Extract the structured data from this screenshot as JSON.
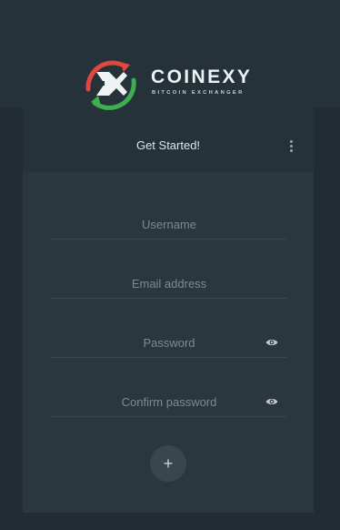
{
  "brand": {
    "name": "COINEXY",
    "tagline": "BITCOIN EXCHANGER"
  },
  "header": {
    "title": "Get Started!",
    "menu_icon": "more-vertical-icon"
  },
  "form": {
    "username": {
      "placeholder": "Username",
      "value": ""
    },
    "email": {
      "placeholder": "Email address",
      "value": ""
    },
    "password": {
      "placeholder": "Password",
      "value": "",
      "toggle_icon": "eye-icon"
    },
    "confirm_password": {
      "placeholder": "Confirm password",
      "value": "",
      "toggle_icon": "eye-icon"
    },
    "submit_icon": "plus-icon",
    "submit_symbol": "+"
  },
  "colors": {
    "background": "#222c33",
    "card": "#26323a",
    "panel": "#2b373f",
    "logo_red": "#e0483f",
    "logo_green": "#3fae4f"
  }
}
